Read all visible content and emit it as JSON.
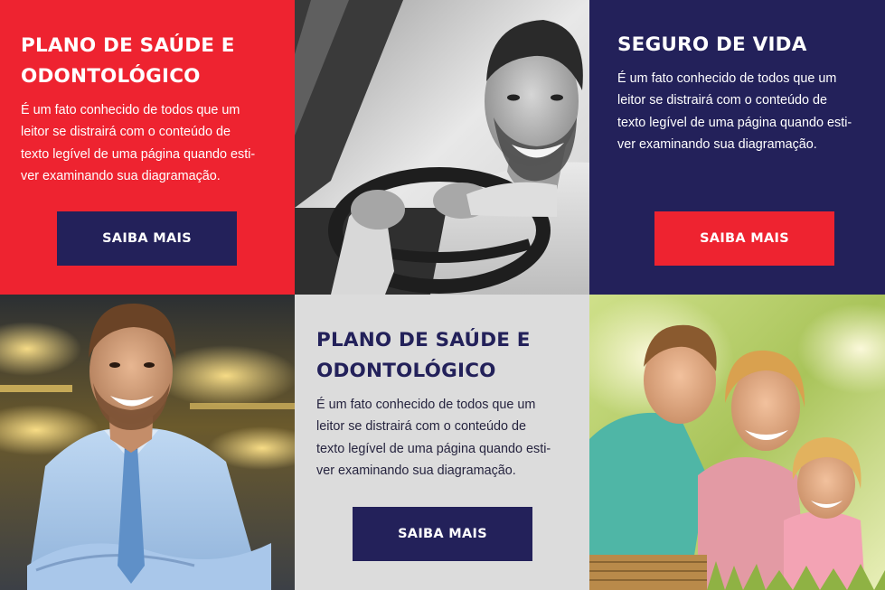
{
  "cards": {
    "health_top": {
      "title_line1": "PLANO DE SAÚDE E",
      "title_line2": "ODONTOLÓGICO",
      "desc_line1": "É um fato conhecido de todos que um",
      "desc_line2": "leitor se distrairá com o conteúdo de",
      "desc_line3": "texto legível de uma página quando esti-",
      "desc_line4": "ver examinando sua diagramação.",
      "button_label": "SAIBA MAIS"
    },
    "life": {
      "title_line1": "SEGURO DE VIDA",
      "desc_line1": "É um fato conhecido de todos que um",
      "desc_line2": "leitor se distrairá com o conteúdo de",
      "desc_line3": "texto legível de uma página quando esti-",
      "desc_line4": "ver examinando sua diagramação.",
      "button_label": "SAIBA MAIS"
    },
    "health_bottom": {
      "title_line1": "PLANO DE SAÚDE E",
      "title_line2": "ODONTOLÓGICO",
      "desc_line1": "É um fato conhecido de todos que um",
      "desc_line2": "leitor se distrairá com o conteúdo de",
      "desc_line3": "texto legível de uma página quando esti-",
      "desc_line4": "ver examinando sua diagramação.",
      "button_label": "SAIBA MAIS"
    }
  },
  "photos": {
    "driver": {
      "depicts": "smiling man driving a car"
    },
    "businessman": {
      "depicts": "smiling man in blue shirt and tie with arms crossed"
    },
    "family": {
      "depicts": "family laughing together outdoors"
    }
  },
  "colors": {
    "red": "#ee2330",
    "navy": "#23215a",
    "gray": "#dcdcdc",
    "white": "#ffffff"
  }
}
